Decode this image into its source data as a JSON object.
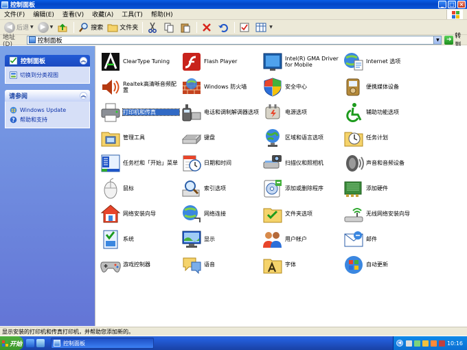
{
  "window": {
    "title": "控制面板",
    "controls": [
      "_",
      "□",
      "×"
    ]
  },
  "menubar": [
    "文件(F)",
    "编辑(E)",
    "查看(V)",
    "收藏(A)",
    "工具(T)",
    "帮助(H)"
  ],
  "toolbar": {
    "back_label": "后退",
    "search_label": "搜索",
    "folders_label": "文件夹"
  },
  "address": {
    "label": "地址(D)",
    "value": "控制面板",
    "go_label": "转到"
  },
  "leftpane": {
    "panel1": {
      "title": "控制面板",
      "links": [
        "切换到分类视图"
      ]
    },
    "panel2": {
      "title": "请参阅",
      "links": [
        "Windows Update",
        "帮助和支持"
      ]
    }
  },
  "items": [
    {
      "label": "ClearType Tuning",
      "icon": "cleartype-icon"
    },
    {
      "label": "Flash Player",
      "icon": "flash-icon"
    },
    {
      "label": "Intel(R) GMA Driver for Mobile",
      "icon": "intel-gma-icon"
    },
    {
      "label": "Internet 选项",
      "icon": "internet-options-icon"
    },
    {
      "label": "Realtek高清晰音频配置",
      "icon": "realtek-audio-icon"
    },
    {
      "label": "Windows 防火墙",
      "icon": "firewall-icon"
    },
    {
      "label": "安全中心",
      "icon": "security-center-icon"
    },
    {
      "label": "便携媒体设备",
      "icon": "portable-media-icon"
    },
    {
      "label": "打印机和传真",
      "icon": "printer-icon",
      "selected": true
    },
    {
      "label": "电话和调制解调器选项",
      "icon": "phone-modem-icon"
    },
    {
      "label": "电源选项",
      "icon": "power-icon"
    },
    {
      "label": "辅助功能选项",
      "icon": "accessibility-icon"
    },
    {
      "label": "管理工具",
      "icon": "admin-tools-icon"
    },
    {
      "label": "键盘",
      "icon": "keyboard-icon"
    },
    {
      "label": "区域和语言选项",
      "icon": "region-language-icon"
    },
    {
      "label": "任务计划",
      "icon": "scheduled-tasks-icon"
    },
    {
      "label": "任务栏和「开始」菜单",
      "icon": "taskbar-start-icon"
    },
    {
      "label": "日期和时间",
      "icon": "date-time-icon"
    },
    {
      "label": "扫描仪和照相机",
      "icon": "scanner-camera-icon"
    },
    {
      "label": "声音和音频设备",
      "icon": "sound-icon"
    },
    {
      "label": "鼠标",
      "icon": "mouse-icon"
    },
    {
      "label": "索引选项",
      "icon": "indexing-icon"
    },
    {
      "label": "添加或删除程序",
      "icon": "add-remove-programs-icon"
    },
    {
      "label": "添加硬件",
      "icon": "add-hardware-icon"
    },
    {
      "label": "网络安装向导",
      "icon": "network-setup-icon"
    },
    {
      "label": "网络连接",
      "icon": "network-connections-icon"
    },
    {
      "label": "文件夹选项",
      "icon": "folder-options-icon"
    },
    {
      "label": "无线网络安装向导",
      "icon": "wireless-setup-icon"
    },
    {
      "label": "系统",
      "icon": "system-icon"
    },
    {
      "label": "显示",
      "icon": "display-icon"
    },
    {
      "label": "用户帐户",
      "icon": "user-accounts-icon"
    },
    {
      "label": "邮件",
      "icon": "mail-icon"
    },
    {
      "label": "游戏控制器",
      "icon": "game-controller-icon"
    },
    {
      "label": "语音",
      "icon": "speech-icon"
    },
    {
      "label": "字体",
      "icon": "fonts-icon"
    },
    {
      "label": "自动更新",
      "icon": "auto-update-icon"
    }
  ],
  "status": {
    "text": "显示安装的打印机和传真打印机，并帮助您添加新的。"
  },
  "taskbar": {
    "start_label": "开始",
    "task_label": "控制面板",
    "clock": "10:16"
  }
}
